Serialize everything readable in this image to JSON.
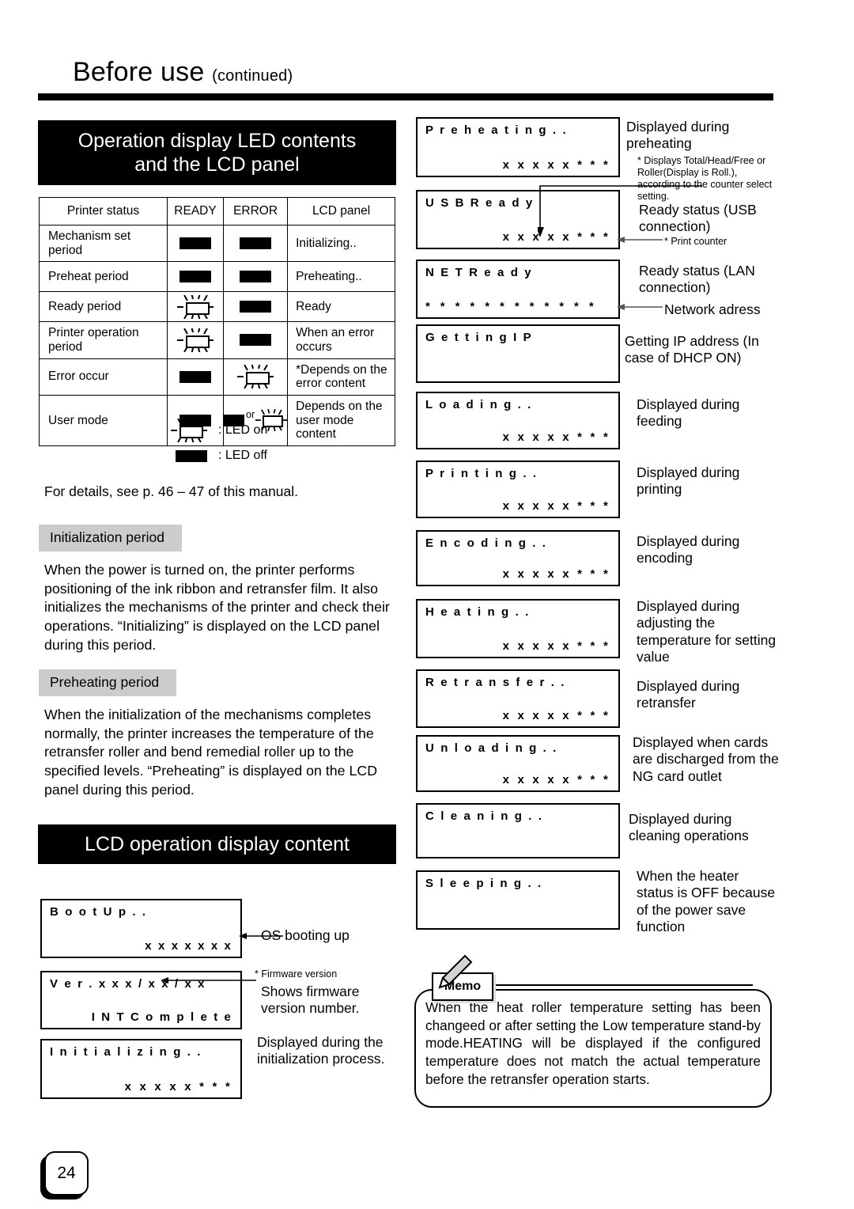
{
  "header": {
    "title": "Before use",
    "continued": "(continued)"
  },
  "sections": {
    "led_panel_title": "Operation display LED contents and the LCD panel",
    "led_panel_title_line1": "Operation display LED contents",
    "led_panel_title_line2": "and the LCD panel",
    "lcd_content_title": "LCD operation display content"
  },
  "led_table": {
    "headers": [
      "Printer status",
      "READY",
      "ERROR",
      "LCD panel"
    ],
    "rows": [
      {
        "status": "Mechanism set period",
        "ready": "off",
        "error": "off",
        "lcd": "Initializing.."
      },
      {
        "status": "Preheat period",
        "ready": "off",
        "error": "off",
        "lcd": "Preheating.."
      },
      {
        "status": "Ready period",
        "ready": "on",
        "error": "off",
        "lcd": "Ready"
      },
      {
        "status": "Printer operation period",
        "ready": "on",
        "error": "off",
        "lcd": "When an error occurs"
      },
      {
        "status": "Error occur",
        "ready": "off",
        "error": "on",
        "lcd": "*Depends on the error content"
      },
      {
        "status": "User mode",
        "ready": "off",
        "error": "off-or-on",
        "lcd": "Depends on the user mode content"
      }
    ],
    "or_label": "or"
  },
  "legend": {
    "led_on": ": LED on",
    "led_off": ": LED off"
  },
  "details_note": "For details, see p. 46 – 47 of this manual.",
  "initialization": {
    "subhead": "Initialization period",
    "body": "When the power is turned on, the printer performs positioning of the ink ribbon and retransfer film.  It also initializes the mechanisms of the printer and check their operations.  “Initializing” is displayed on the LCD panel during this period."
  },
  "preheating": {
    "subhead": "Preheating period",
    "body": "When the initialization of the mechanisms completes normally, the printer increases the temperature of the retransfer roller and bend remedial roller up to the specified levels.  “Preheating” is displayed on the LCD panel during this period."
  },
  "lcd_left": [
    {
      "line1": "B o o t  U p . .",
      "line2": "x x x x x x x",
      "caption": "OS booting up"
    },
    {
      "line1": "V e r .  x x x / x x / x x",
      "line2": "I N T  C o m p l e t e",
      "note": "* Firmware version",
      "caption": "Shows firmware version number."
    },
    {
      "line1": "I n i t i a l i z i n g . .",
      "line2": "x x x x x    * * *",
      "caption": "Displayed during the initialization process."
    }
  ],
  "lcd_right": [
    {
      "line1": "P r e h e a t i n g . .",
      "line2": "x x x x x    * * *",
      "caption": "Displayed during preheating",
      "note": "* Displays Total/Head/Free or Roller(Display is Roll.), according to the counter select setting."
    },
    {
      "line1": "U S B  R e a d y",
      "line2": "x x x x x    * * *",
      "caption": "Ready status (USB connection)",
      "note": "* Print counter"
    },
    {
      "line1": "N E T  R e a d y",
      "line2": "* * * * * *  * * *  * * *",
      "caption": "Ready status (LAN connection)",
      "note": "Network adress"
    },
    {
      "line1": "G e t t i n g  I P",
      "line2": "",
      "caption": "Getting IP address (In case of DHCP ON)"
    },
    {
      "line1": "L o a d i n g . .",
      "line2": "x x x x x    * * *",
      "caption": "Displayed during feeding"
    },
    {
      "line1": "P r i n t i n g . .",
      "line2": "x x x x x    * * *",
      "caption": "Displayed during printing"
    },
    {
      "line1": "E n c o d i n g . .",
      "line2": "x x x x x    * * *",
      "caption": "Displayed during encoding"
    },
    {
      "line1": "H e a t i n g . .",
      "line2": "x x x x x    * * *",
      "caption": "Displayed during adjusting the temperature for setting value"
    },
    {
      "line1": "R e t r a n s f e r . .",
      "line2": "x x x x x    * * *",
      "caption": "Displayed during retransfer"
    },
    {
      "line1": "U n l o a d i n g . .",
      "line2": "x x x x x    * * *",
      "caption": "Displayed when cards are discharged from the NG card outlet"
    },
    {
      "line1": "C l e a n i n g . .",
      "line2": "",
      "caption": "Displayed during cleaning operations"
    },
    {
      "line1": "S l e e p i n g . .",
      "line2": "",
      "caption": "When the heater status is OFF because of the power save function"
    }
  ],
  "memo": {
    "label": "Memo",
    "text": "When the heat roller temperature setting has been changeed or after setting the Low temperature stand-by mode.HEATING will be displayed if the configured temperature does not match the actual temperature before the  retransfer operation starts."
  },
  "page_number": "24"
}
